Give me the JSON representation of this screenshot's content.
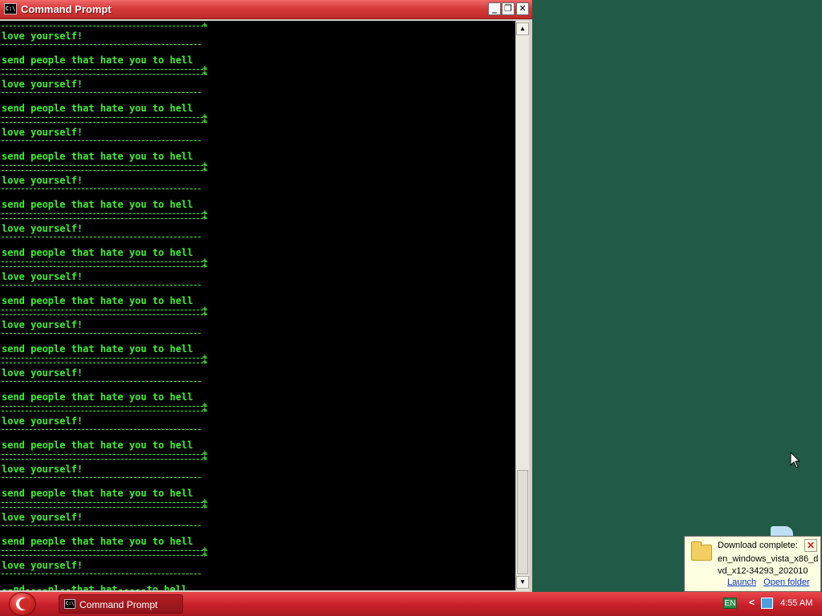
{
  "window": {
    "title": "Command Prompt",
    "icon_label": "C:\\",
    "buttons": {
      "minimize": "_",
      "maximize": "❐",
      "close": "✕"
    }
  },
  "console": {
    "text_color": "#3ef02e",
    "lines": [
      "love yourself!",
      "send people that hate you to hell",
      "love yourself!",
      "send people that hate you to hell",
      "love yourself!",
      "send people that hate you to hell",
      "love yourself!",
      "send people that hate you to hell",
      "love yourself!",
      "send people that hate you to hell",
      "love yourself!",
      "send people that hate you to hell",
      "love yourself!",
      "send people that hate you to hell",
      "love yourself!",
      "send people that hate you to hell",
      "love yourself!",
      "send people that hate you to hell",
      "love yourself!",
      "send people that hate you to hell",
      "love yourself!",
      "send people that hate you to hell",
      "love yourself!",
      "--nd----pl--that hat-----to hell"
    ]
  },
  "notification": {
    "heading": "Download complete:",
    "filename": "en_windows_vista_x86_dvd_x12-34293_202010",
    "launch": "Launch",
    "open_folder": "Open folder"
  },
  "taskbar": {
    "task_label": "Command Prompt",
    "language": "EN",
    "chevron": "<",
    "clock": "4:55 AM"
  },
  "colors": {
    "desktop": "#215b47",
    "taskbar": "#c8202a",
    "console_bg": "#000000"
  },
  "icons": [
    "cmd-icon",
    "folder-icon",
    "close-icon",
    "start-orb-icon",
    "network-icon",
    "mouse-cursor-icon"
  ]
}
